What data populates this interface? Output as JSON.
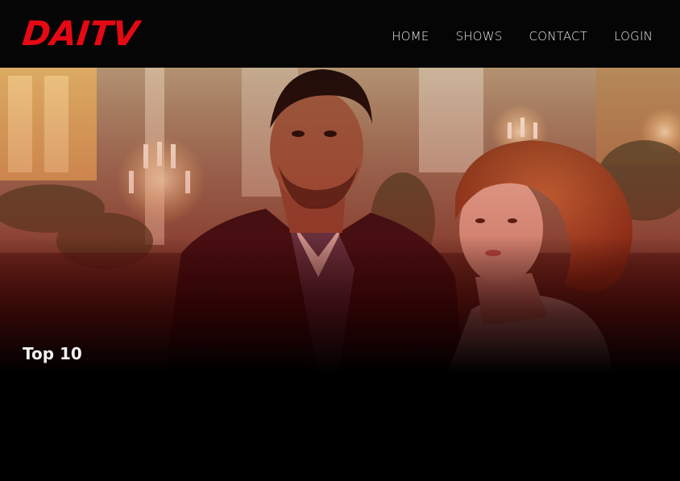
{
  "brand": {
    "logo_text": "DAITV",
    "logo_color": "#e50914"
  },
  "nav": {
    "items": [
      {
        "label": "HOME"
      },
      {
        "label": "SHOWS"
      },
      {
        "label": "CONTACT"
      },
      {
        "label": "LOGIN"
      }
    ]
  },
  "hero": {
    "title": "Top 10",
    "overlay_color": "#8a0000"
  }
}
